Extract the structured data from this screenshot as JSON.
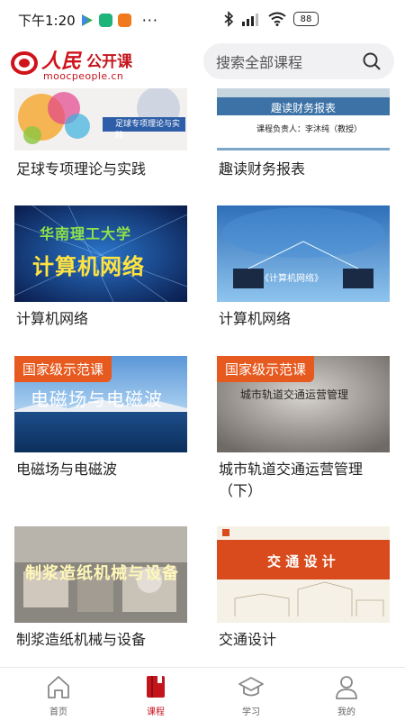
{
  "status_bar": {
    "time": "下午1:20",
    "dots": "···",
    "battery": "88"
  },
  "header": {
    "logo_cn_main": "人民",
    "logo_cn_sub": "公开课",
    "logo_en": "moocpeople.cn",
    "search_placeholder": "搜索全部课程"
  },
  "courses": [
    {
      "title": "足球专项理论与实践",
      "thumb_caption": "足球专项理论与实践",
      "badge": ""
    },
    {
      "title": "趣读财务报表",
      "thumb_caption": "趣读财务报表",
      "thumb_sub": "课程负责人：李沐纯（教授）",
      "badge": ""
    },
    {
      "title": "计算机网络",
      "thumb_caption": "计算机网络",
      "thumb_sub": "华南理工大学",
      "badge": ""
    },
    {
      "title": "计算机网络",
      "thumb_caption": "《计算机网络》",
      "badge": ""
    },
    {
      "title": "电磁场与电磁波",
      "thumb_caption": "电磁场与电磁波",
      "badge": "国家级示范课"
    },
    {
      "title": "城市轨道交通运营管理（下）",
      "thumb_caption": "城市轨道交通运营管理",
      "badge": "国家级示范课"
    },
    {
      "title": "制浆造纸机械与设备",
      "thumb_caption": "制浆造纸机械与设备",
      "badge": ""
    },
    {
      "title": "交通设计",
      "thumb_caption": "交 通 设 计",
      "badge": ""
    }
  ],
  "bottom_nav": [
    {
      "label": "首页",
      "icon": "home-icon"
    },
    {
      "label": "课程",
      "icon": "book-icon",
      "active": true
    },
    {
      "label": "学习",
      "icon": "graduation-cap-icon"
    },
    {
      "label": "我的",
      "icon": "user-icon"
    }
  ],
  "colors": {
    "brand_red": "#c4141c",
    "badge_orange": "#e75a1f",
    "search_bg": "#f1f1f3"
  }
}
